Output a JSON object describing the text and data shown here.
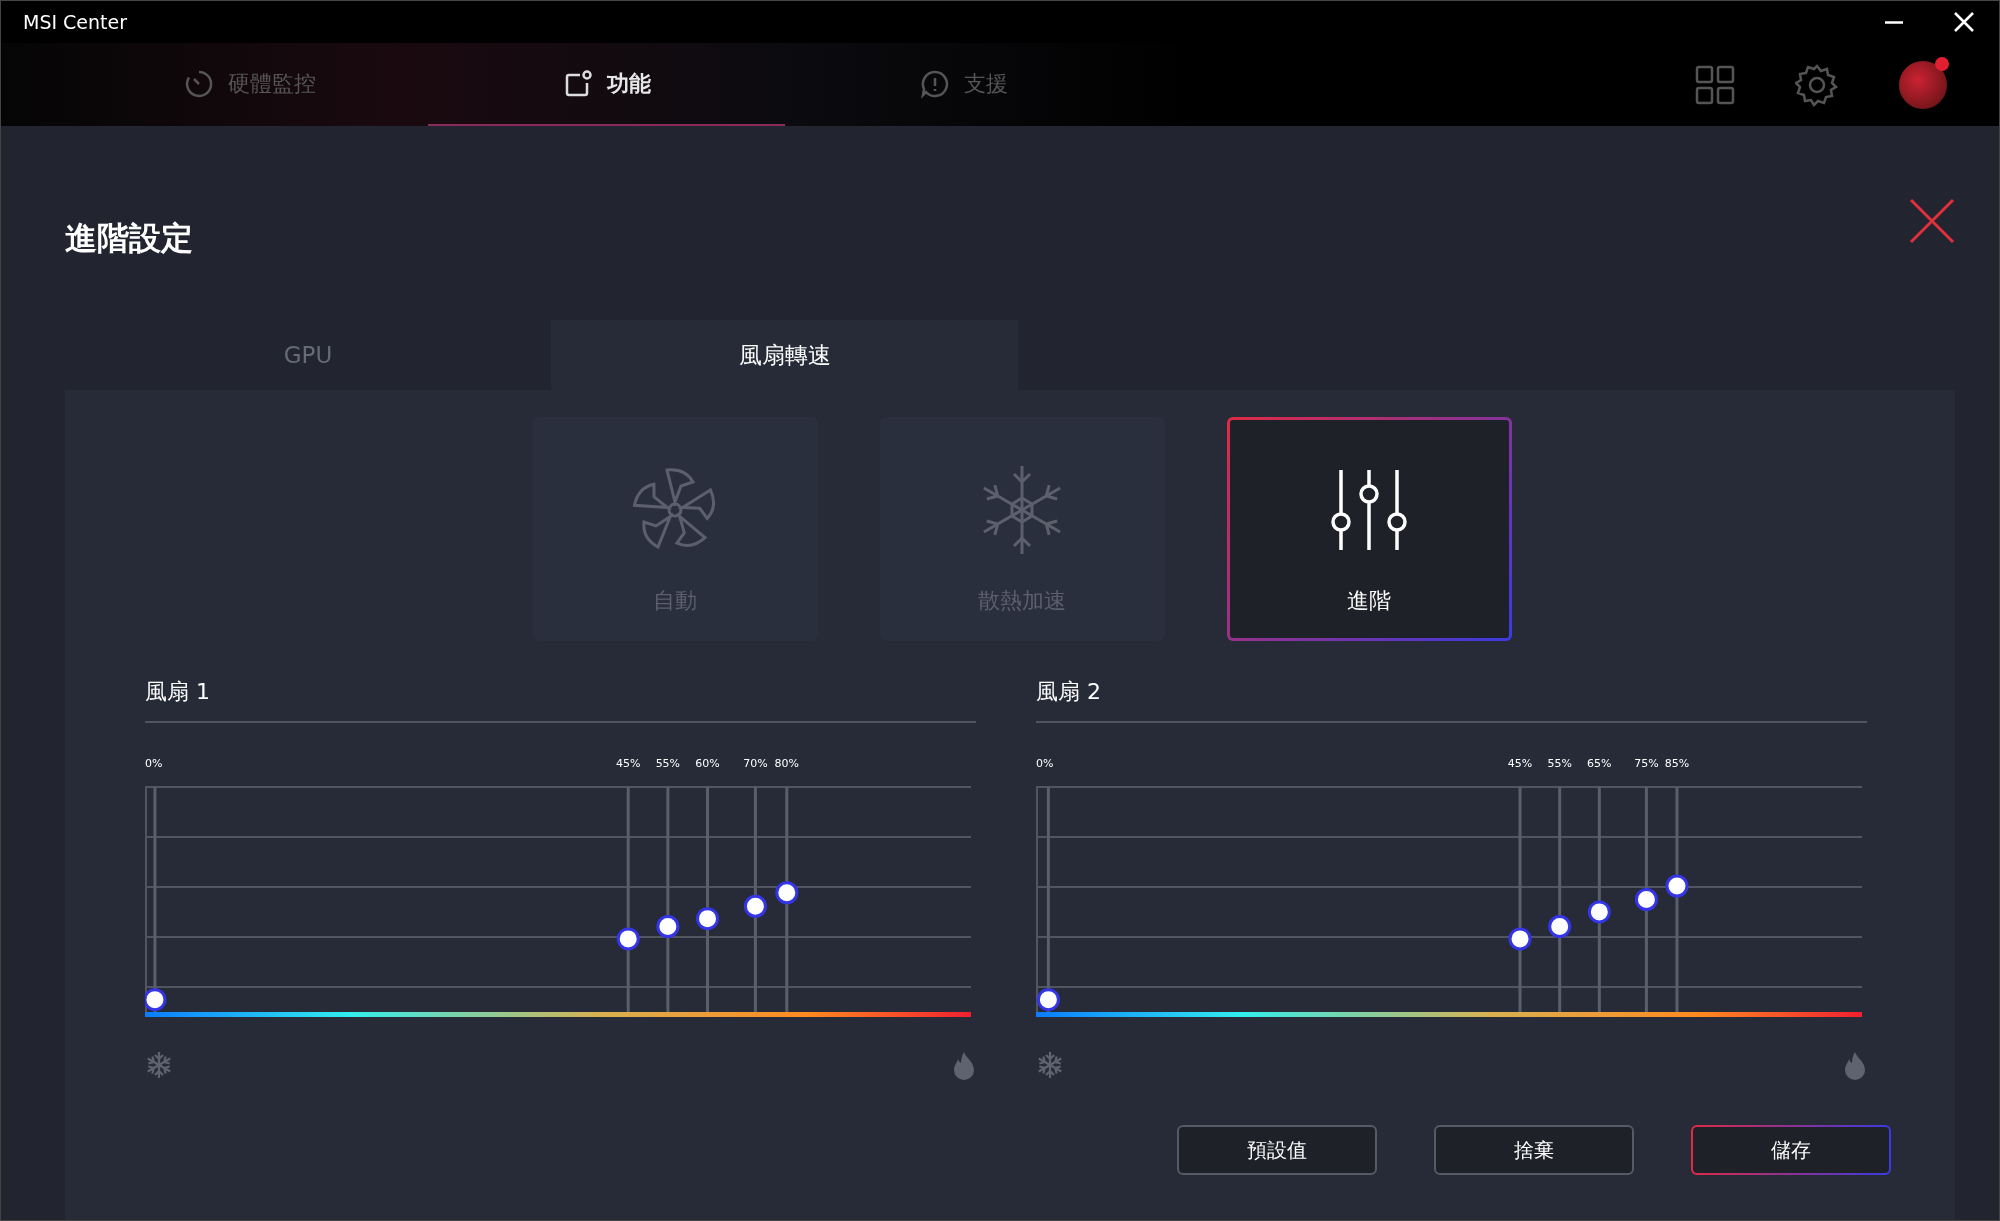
{
  "window": {
    "title": "MSI Center"
  },
  "nav_tabs": [
    {
      "label": "硬體監控",
      "selected": false
    },
    {
      "label": "功能",
      "selected": true
    },
    {
      "label": "支援",
      "selected": false
    }
  ],
  "page_title": "進階設定",
  "sub_tabs": [
    {
      "label": "GPU",
      "selected": false
    },
    {
      "label": "風扇轉速",
      "selected": true
    }
  ],
  "modes": [
    {
      "label": "自動",
      "kind": "fan",
      "selected": false
    },
    {
      "label": "散熱加速",
      "kind": "snowflake",
      "selected": false
    },
    {
      "label": "進階",
      "kind": "sliders",
      "selected": true
    }
  ],
  "fans": [
    {
      "title": "風扇 1",
      "point_labels": [
        "0%",
        "45%",
        "55%",
        "60%",
        "70%",
        "80%"
      ]
    },
    {
      "title": "風扇 2",
      "point_labels": [
        "0%",
        "45%",
        "55%",
        "65%",
        "75%",
        "85%"
      ]
    }
  ],
  "buttons": [
    {
      "label": "預設值",
      "primary": false
    },
    {
      "label": "捨棄",
      "primary": false
    },
    {
      "label": "儲存",
      "primary": true
    }
  ]
}
